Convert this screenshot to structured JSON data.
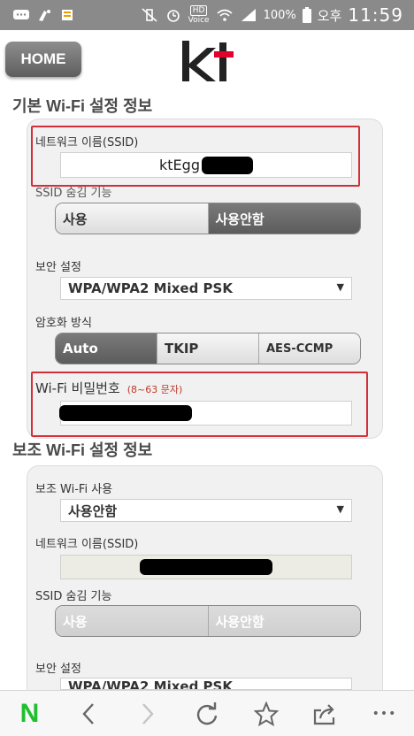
{
  "status_bar": {
    "battery": "100%",
    "ampm": "오후",
    "time": "11:59",
    "hd_label": "HD",
    "voice_label": "Voice"
  },
  "header": {
    "home_label": "HOME",
    "logo_text": "kt"
  },
  "basic_section": {
    "title": "기본 Wi-Fi 설정 정보",
    "network_name_label": "네트워크 이름(SSID)",
    "ssid_value": "ktEgg",
    "ssid_hide_label": "SSID 숨김 기능",
    "ssid_hide_options": [
      "사용",
      "사용안함"
    ],
    "ssid_hide_selected": "사용안함",
    "security_label": "보안 설정",
    "security_value": "WPA/WPA2 Mixed PSK",
    "encryption_label": "암호화 방식",
    "encryption_options": [
      "Auto",
      "TKIP",
      "AES-CCMP"
    ],
    "encryption_selected": "Auto",
    "password_label": "Wi-Fi 비밀번호",
    "password_hint": "(8~63 문자)"
  },
  "aux_section": {
    "title": "보조 Wi-Fi 설정 정보",
    "use_label": "보조 Wi-Fi 사용",
    "use_value": "사용안함",
    "network_name_label": "네트워크 이름(SSID)",
    "ssid_hide_label": "SSID 숨김 기능",
    "ssid_hide_options": [
      "사용",
      "사용안함"
    ],
    "security_label": "보안 설정",
    "security_value": "WPA/WPA2 Mixed PSK"
  },
  "bottom_nav": {
    "naver_letter": "N",
    "more_label": "•••"
  },
  "colors": {
    "status_bar": "#8a8a8a",
    "kt_red": "#e4002b",
    "highlight_red": "#d32f3a",
    "naver_green": "#1fbf2f"
  }
}
